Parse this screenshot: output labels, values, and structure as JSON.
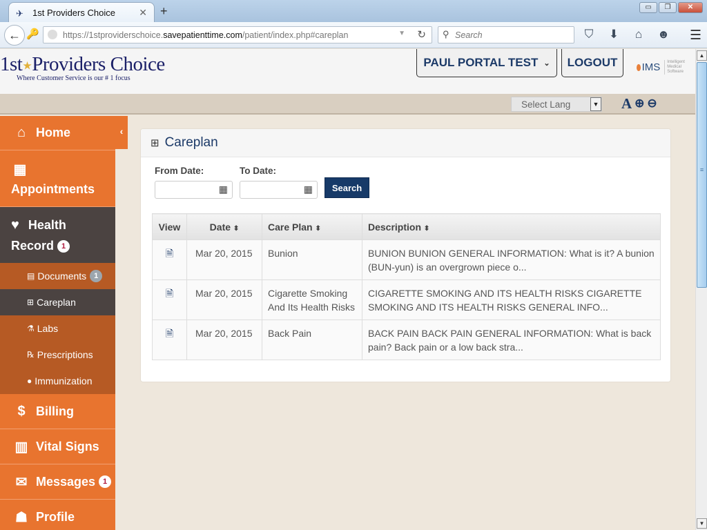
{
  "browser": {
    "tab_title": "1st Providers Choice",
    "tab_close": "✕",
    "new_tab": "+",
    "url_prefix": "https://1stproviderschoice.",
    "url_domain": "savepatienttime.com",
    "url_path": "/patient/index.php#careplan",
    "search_placeholder": "Search",
    "window_buttons": {
      "minimize": "▭",
      "restore": "❐",
      "close": "✕"
    }
  },
  "header": {
    "logo_name_a": "1st",
    "logo_star": "★",
    "logo_name_b": "Providers Choice",
    "logo_tagline": "Where Customer Service is our # 1 focus",
    "user_button": "PAUL PORTAL TEST",
    "logout_button": "LOGOUT",
    "ims_logo": "IMS",
    "ims_subtitle": "Intelligent Medical Software"
  },
  "toolbar": {
    "language_select": "Select Lang",
    "font_icon": "A"
  },
  "sidebar": {
    "home": "Home",
    "appointments": "Appointments",
    "health_record_a": "Health",
    "health_record_b": "Record",
    "health_record_badge": "1",
    "submenu": {
      "documents": "Documents",
      "documents_badge": "1",
      "careplan": "Careplan",
      "labs": "Labs",
      "prescriptions": "Prescriptions",
      "immunization": "Immunization"
    },
    "billing": "Billing",
    "vital_signs": "Vital Signs",
    "messages": "Messages",
    "messages_badge": "1",
    "profile": "Profile",
    "active_item": "Careplan"
  },
  "panel": {
    "title": "Careplan",
    "from_date_label": "From Date:",
    "from_date_value": "",
    "to_date_label": "To Date:",
    "to_date_value": "",
    "search_button": "Search"
  },
  "table": {
    "columns": [
      "View",
      "Date",
      "Care Plan",
      "Description"
    ],
    "sort_glyph": "⬍",
    "rows": [
      {
        "date": "Mar 20, 2015",
        "plan": "Bunion",
        "description": "BUNION BUNION GENERAL INFORMATION: What is it? A bunion (BUN-yun) is an overgrown piece o..."
      },
      {
        "date": "Mar 20, 2015",
        "plan": "Cigarette Smoking And Its Health Risks",
        "description": "CIGARETTE SMOKING AND ITS HEALTH RISKS CIGARETTE SMOKING AND ITS HEALTH RISKS GENERAL INFO..."
      },
      {
        "date": "Mar 20, 2015",
        "plan": "Back Pain",
        "description": "BACK PAIN BACK PAIN GENERAL INFORMATION: What is back pain? Back pain or a low back stra..."
      }
    ]
  },
  "colors": {
    "sidebar_orange": "#e8742f",
    "sidebar_dark": "#4b4341",
    "submenu_orange": "#b65a24",
    "primary_navy": "#173a68",
    "background": "#eee7dc"
  }
}
